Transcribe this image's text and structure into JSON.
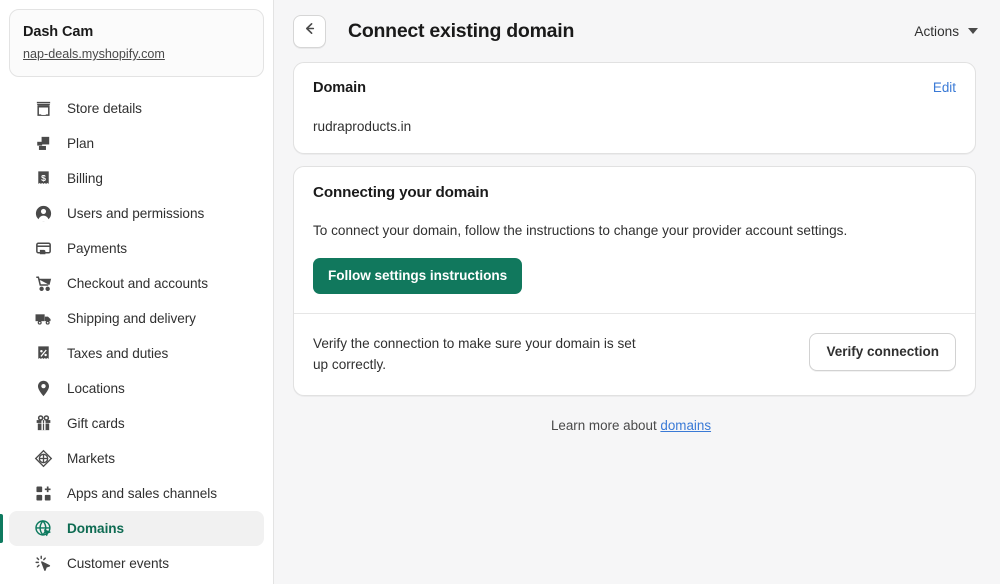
{
  "sidebar": {
    "shop": {
      "name": "Dash Cam",
      "url": "nap-deals.myshopify.com"
    },
    "items": [
      {
        "label": "Store details",
        "icon": "store-icon",
        "active": false
      },
      {
        "label": "Plan",
        "icon": "plan-icon",
        "active": false
      },
      {
        "label": "Billing",
        "icon": "billing-icon",
        "active": false
      },
      {
        "label": "Users and permissions",
        "icon": "user-icon",
        "active": false
      },
      {
        "label": "Payments",
        "icon": "payments-icon",
        "active": false
      },
      {
        "label": "Checkout and accounts",
        "icon": "cart-icon",
        "active": false
      },
      {
        "label": "Shipping and delivery",
        "icon": "truck-icon",
        "active": false
      },
      {
        "label": "Taxes and duties",
        "icon": "percent-receipt-icon",
        "active": false
      },
      {
        "label": "Locations",
        "icon": "location-pin-icon",
        "active": false
      },
      {
        "label": "Gift cards",
        "icon": "gift-icon",
        "active": false
      },
      {
        "label": "Markets",
        "icon": "markets-globe-icon",
        "active": false
      },
      {
        "label": "Apps and sales channels",
        "icon": "apps-grid-plus-icon",
        "active": false
      },
      {
        "label": "Domains",
        "icon": "domains-globe-icon",
        "active": true
      },
      {
        "label": "Customer events",
        "icon": "customer-events-icon",
        "active": false
      }
    ]
  },
  "header": {
    "back_label": "Back",
    "title": "Connect existing domain",
    "actions_label": "Actions"
  },
  "domain_card": {
    "title": "Domain",
    "edit_label": "Edit",
    "domain_value": "rudraproducts.in"
  },
  "connect_card": {
    "title": "Connecting your domain",
    "description": "To connect your domain, follow the instructions to change your provider account settings.",
    "primary_button": "Follow settings instructions",
    "verify_text": "Verify the connection to make sure your domain is set up correctly.",
    "verify_button": "Verify connection"
  },
  "footer": {
    "learn_more_prefix": "Learn more about ",
    "learn_more_link": "domains"
  },
  "annotation": {
    "type": "up-arrow",
    "color": "#e8232a",
    "points_at": "Verify connection"
  },
  "colors": {
    "brand_green": "#11785d",
    "active_green": "#0e7a5f",
    "link_blue": "#3a7ad6",
    "page_bg": "#f6f6f7",
    "annotation_red": "#e8232a"
  }
}
